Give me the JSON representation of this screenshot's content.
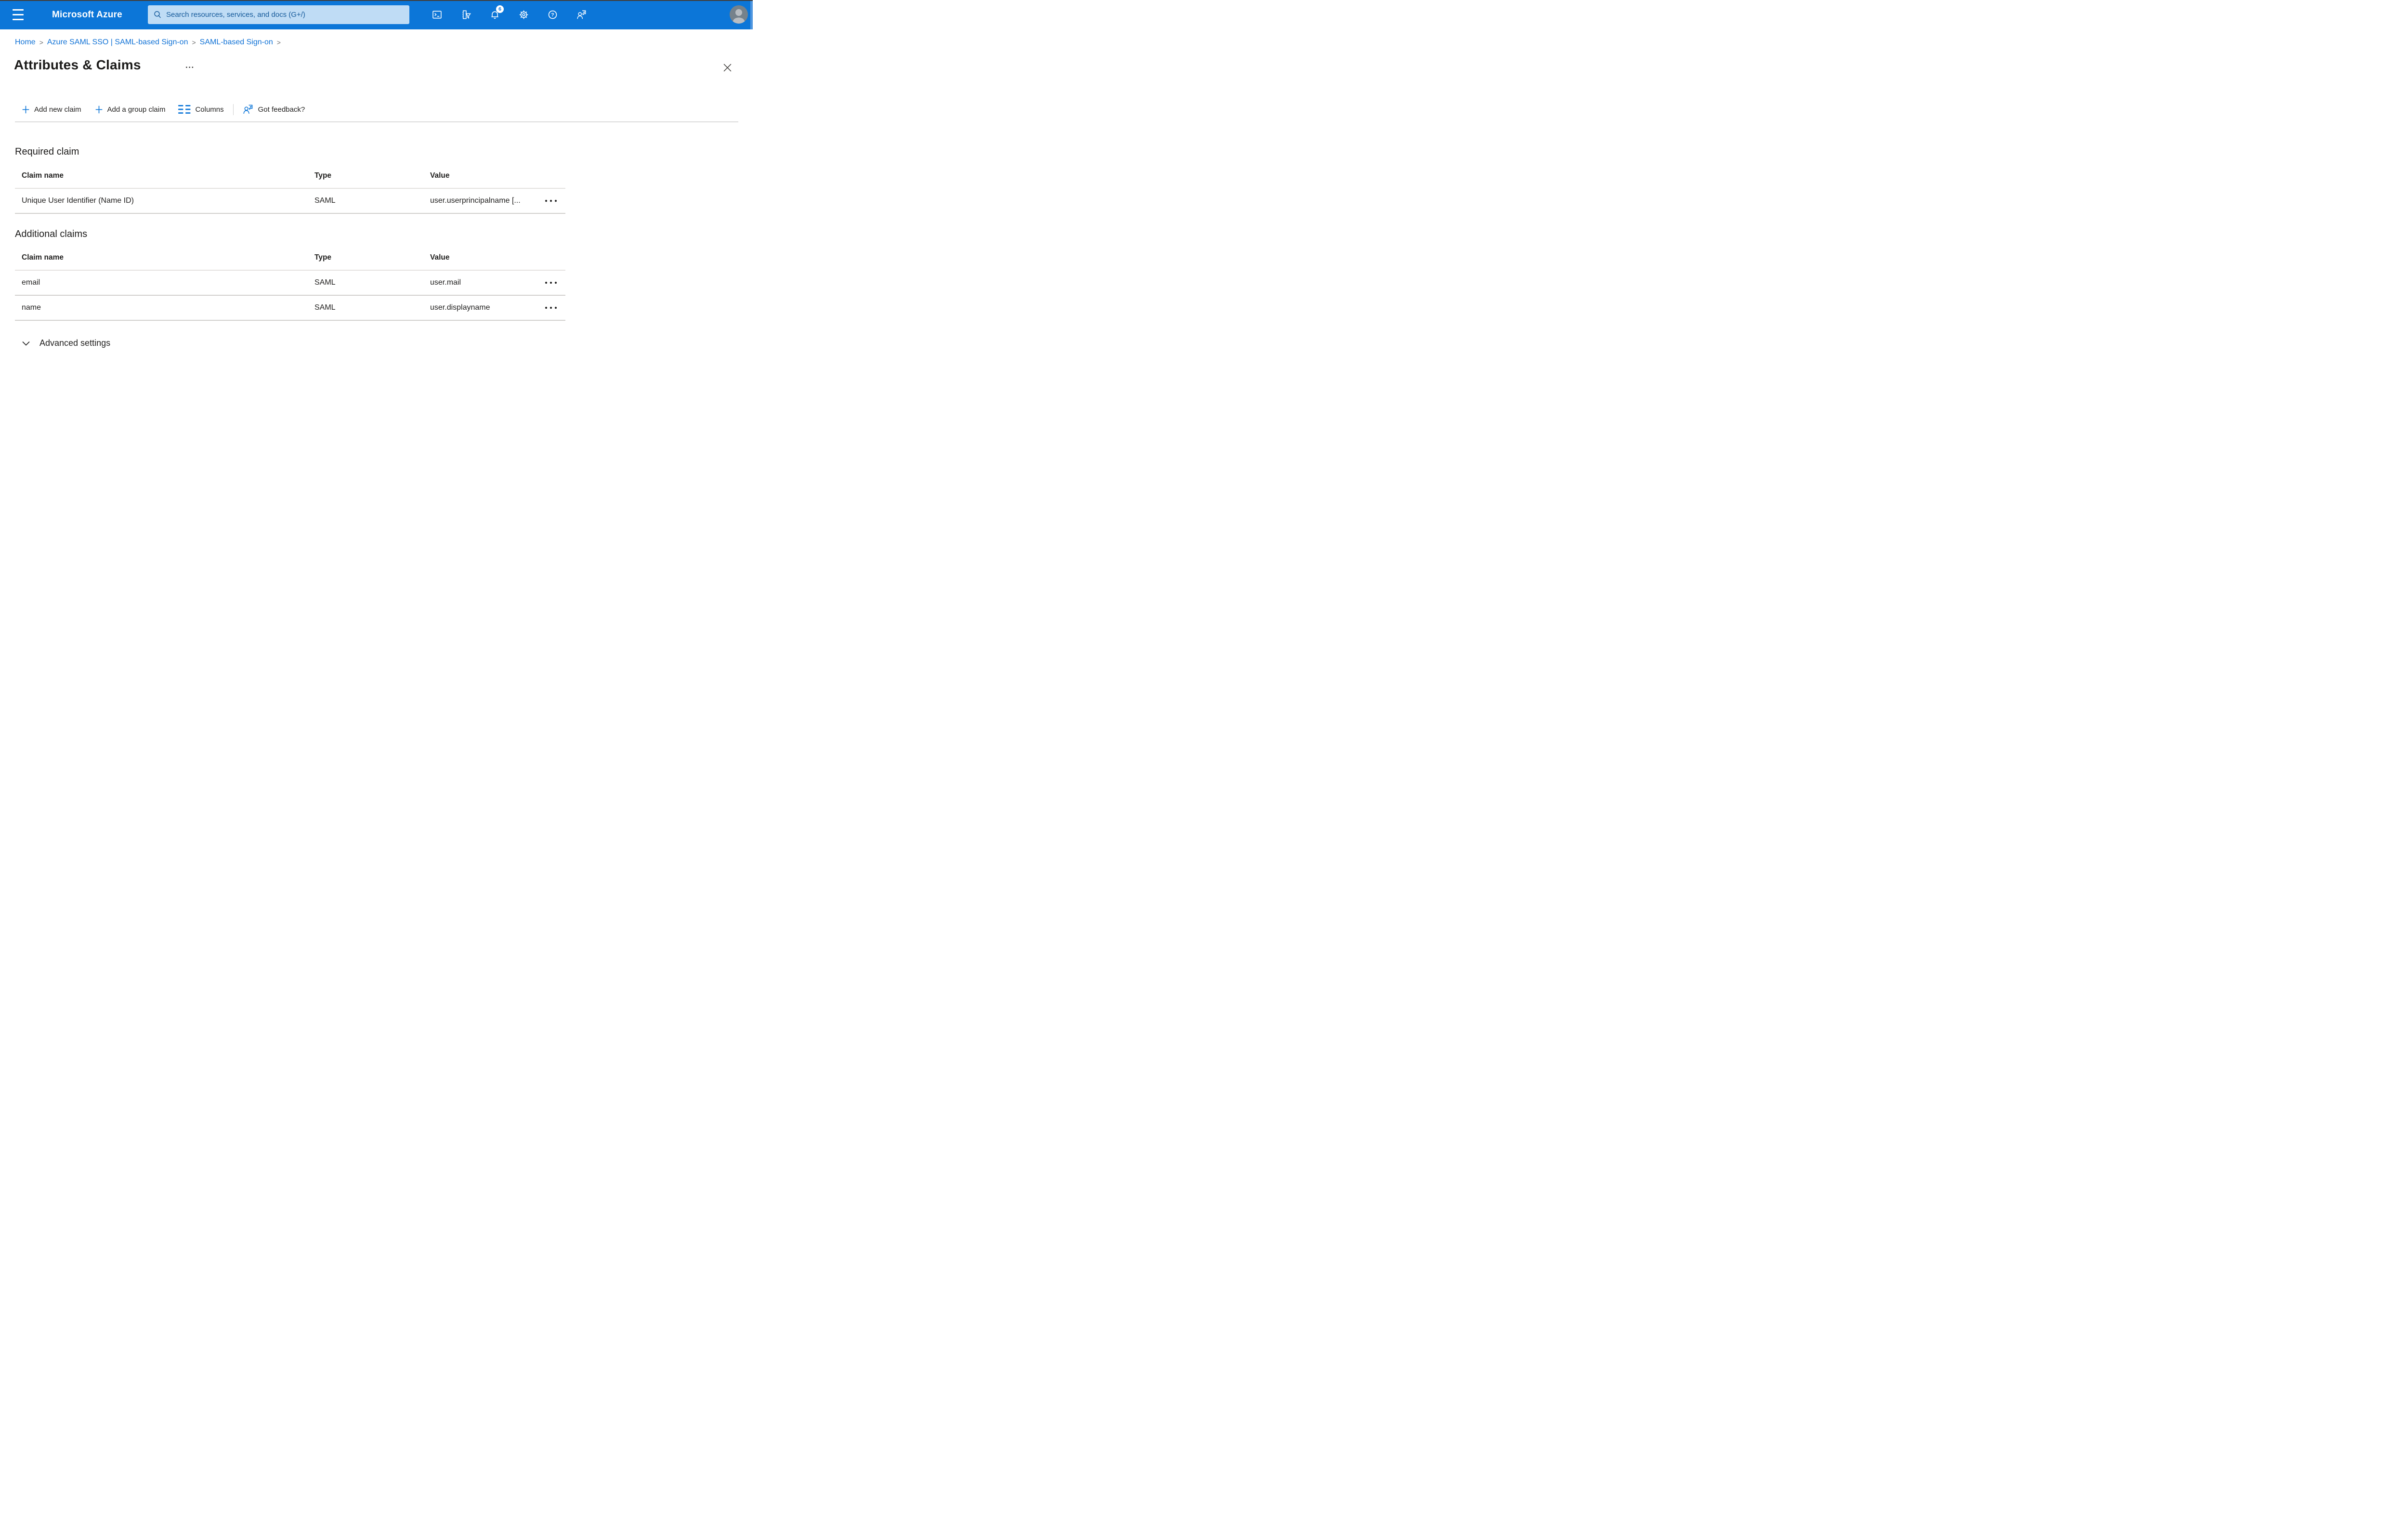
{
  "topbar": {
    "brand": "Microsoft Azure",
    "search": {
      "placeholder": "Search resources, services, and docs (G+/)"
    },
    "notifications_badge": "6",
    "icon_names": [
      "cloud-shell",
      "directory-filter",
      "notifications-bell",
      "settings-gear",
      "help",
      "feedback-person"
    ]
  },
  "breadcrumb": {
    "separator": ">",
    "items": [
      "Home",
      "Azure SAML SSO | SAML-based Sign-on",
      "SAML-based Sign-on"
    ]
  },
  "page": {
    "title": "Attributes & Claims"
  },
  "toolbar": {
    "buttons": [
      {
        "icon": "plus",
        "label": "Add new claim"
      },
      {
        "icon": "plus",
        "label": "Add a group claim"
      },
      {
        "icon": "columns",
        "label": "Columns"
      },
      {
        "icon": "feedback-person",
        "label": "Got feedback?"
      }
    ]
  },
  "required_claim": {
    "heading": "Required claim",
    "columns": [
      "Claim name",
      "Type",
      "Value"
    ],
    "rows": [
      {
        "claim_name": "Unique User Identifier (Name ID)",
        "type": "SAML",
        "value": "user.userprincipalname [..."
      }
    ]
  },
  "additional_claims": {
    "heading": "Additional claims",
    "columns": [
      "Claim name",
      "Type",
      "Value"
    ],
    "rows": [
      {
        "claim_name": "email",
        "type": "SAML",
        "value": "user.mail"
      },
      {
        "claim_name": "name",
        "type": "SAML",
        "value": "user.displayname"
      }
    ]
  },
  "advanced_settings": {
    "label": "Advanced settings"
  },
  "colors": {
    "brand_blue": "#0C76D8",
    "link_blue": "#1072D6",
    "search_bg": "#BFDCF5",
    "search_text": "#14599A",
    "badge_bg": "#FFFFFF",
    "badge_text": "#0C76D8",
    "text_dark": "#201F1E",
    "divider_light": "#DCDCDC",
    "row_border": "#D2D0CE"
  }
}
